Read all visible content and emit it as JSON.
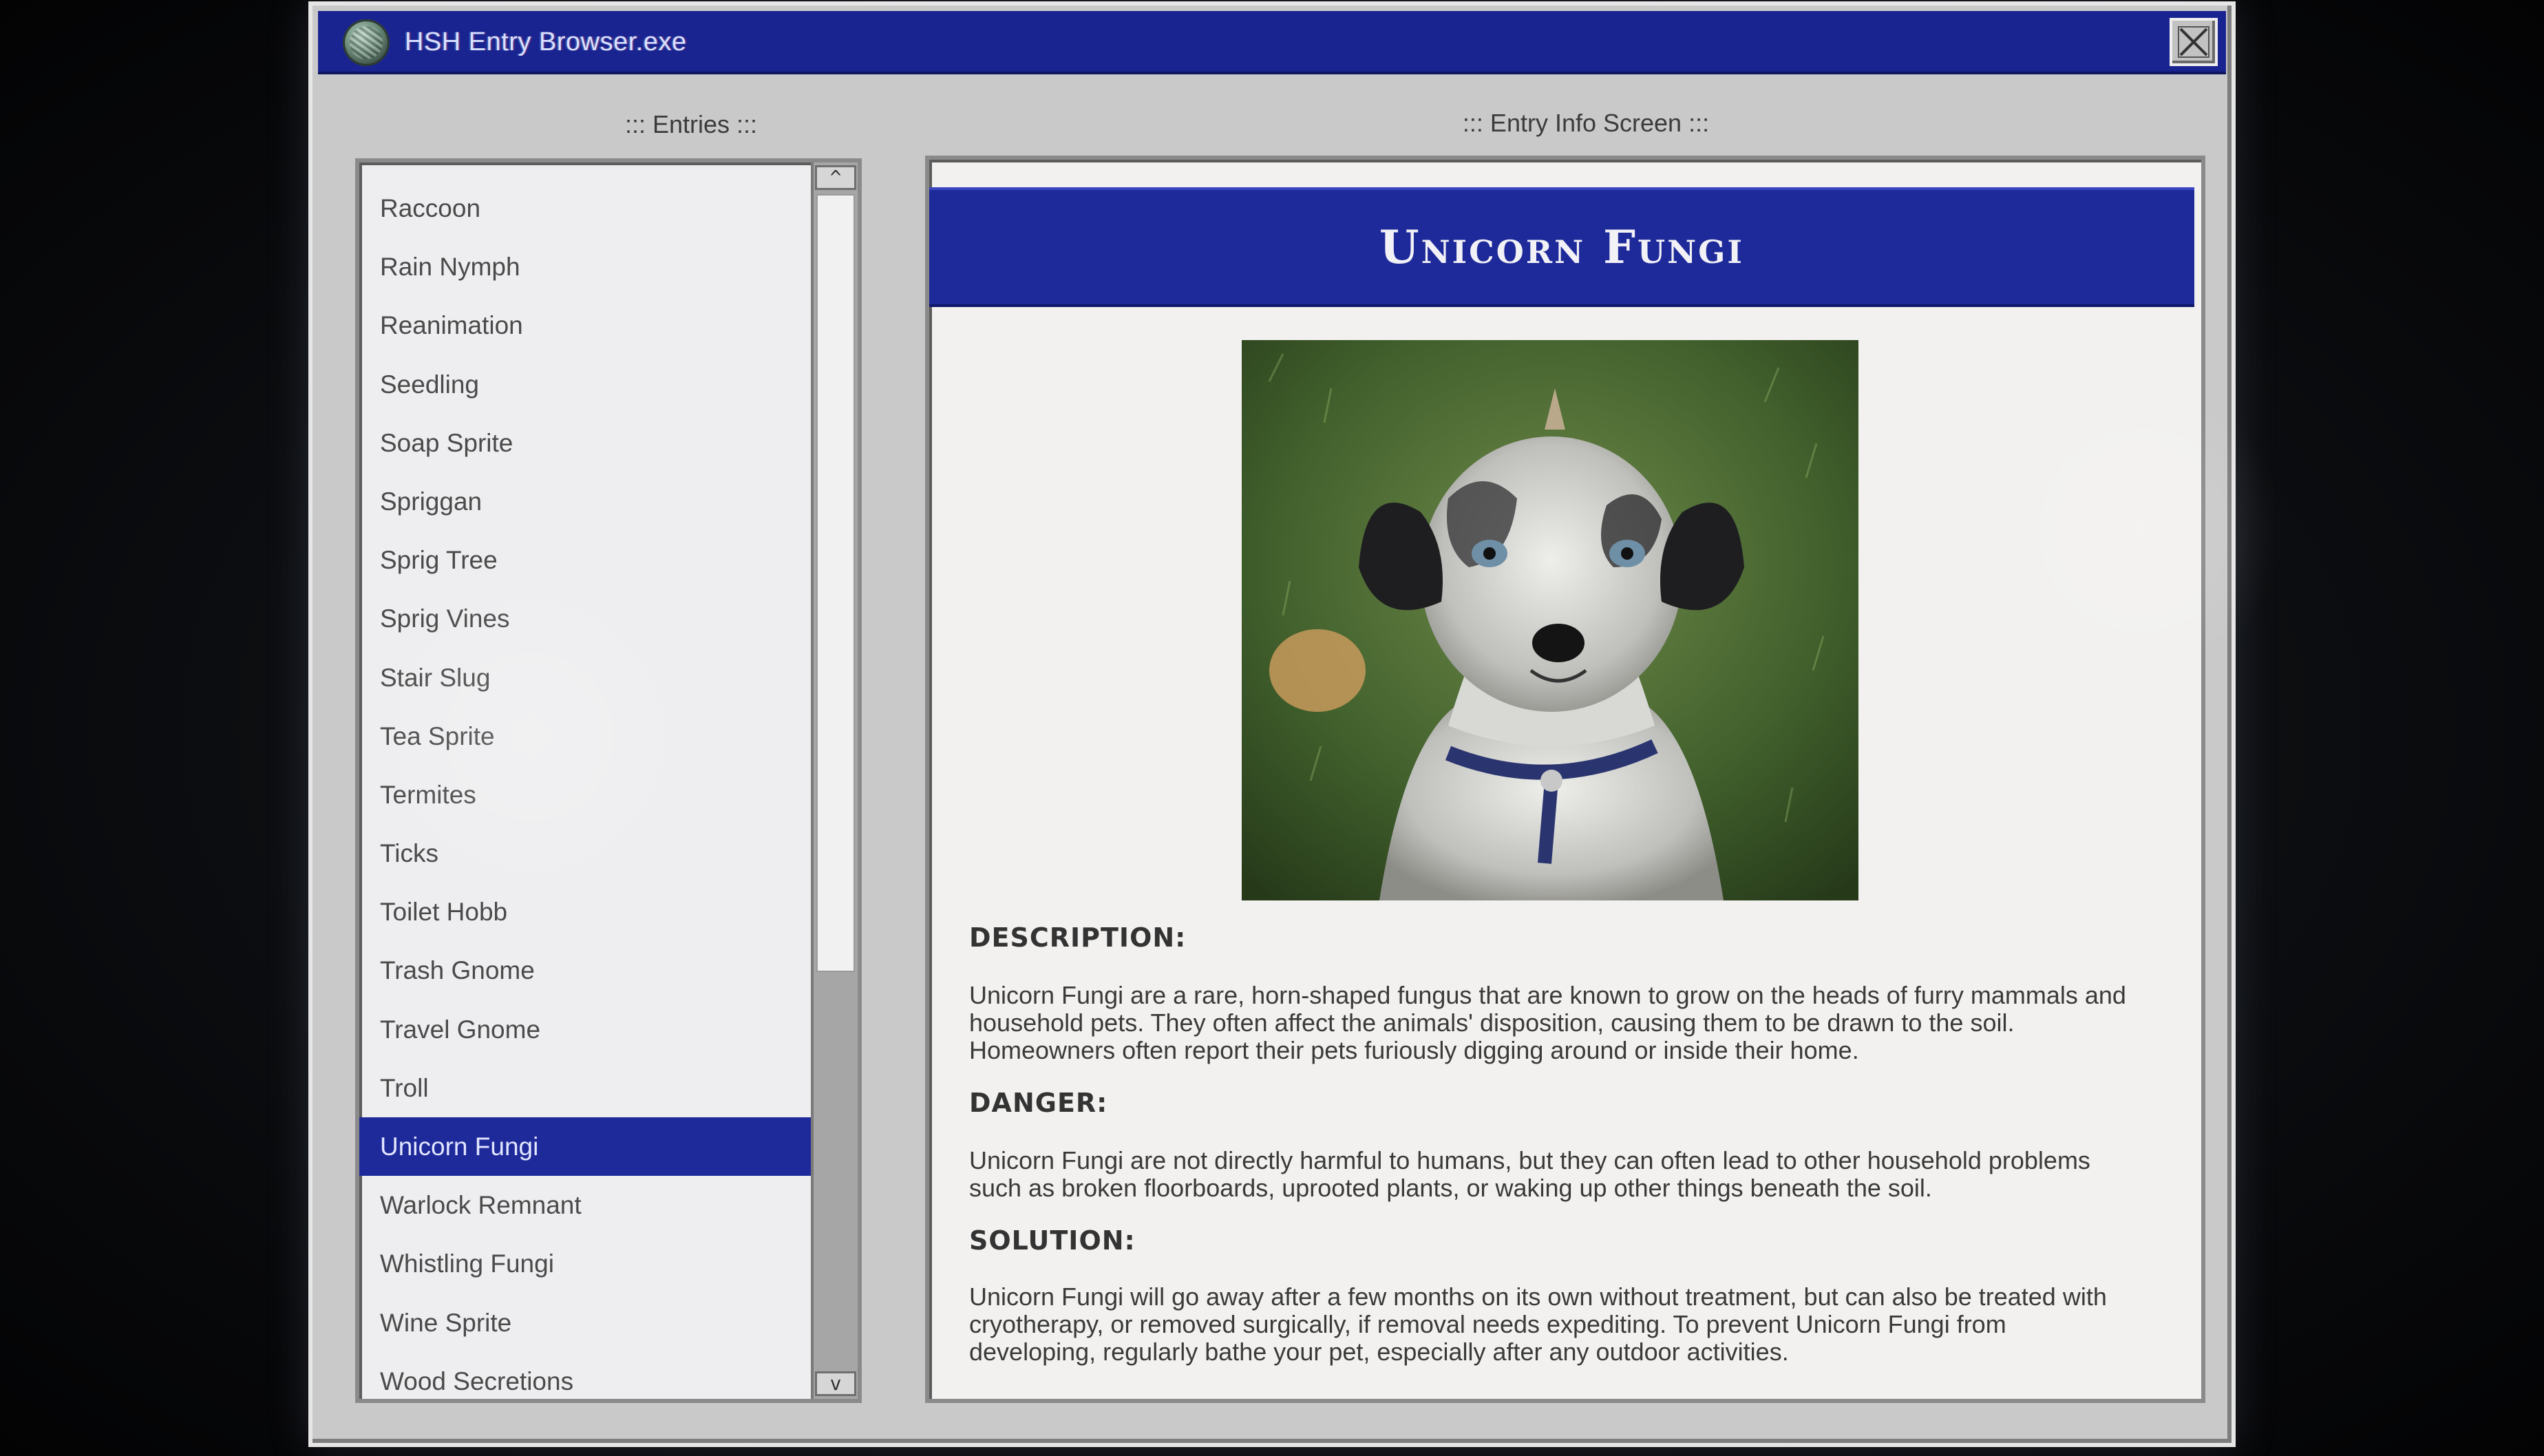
{
  "window": {
    "title": "HSH Entry Browser.exe",
    "icon": "globe-icon",
    "close_icon": "close-icon"
  },
  "entries_pane": {
    "label": "::: Entries :::",
    "scroll_up_glyph": "^",
    "scroll_down_glyph": "v",
    "items": [
      "Raccoon",
      "Rain Nymph",
      "Reanimation",
      "Seedling",
      "Soap Sprite",
      "Spriggan",
      "Sprig Tree",
      "Sprig Vines",
      "Stair Slug",
      "Tea Sprite",
      "Termites",
      "Ticks",
      "Toilet Hobb",
      "Trash Gnome",
      "Travel Gnome",
      "Troll",
      "Unicorn Fungi",
      "Warlock Remnant",
      "Whistling Fungi",
      "Wine Sprite",
      "Wood Secretions"
    ],
    "selected": "Unicorn Fungi"
  },
  "info_pane": {
    "label": "::: Entry Info Screen :::",
    "entry_title": "Unicorn Fungi",
    "sections": {
      "description_head": "DESCRIPTION:",
      "description_body": "Unicorn Fungi are a rare, horn-shaped fungus that are known to grow on the heads of furry mammals and household pets. They often affect the animals' disposition, causing them to be drawn to the soil. Homeowners often report their pets furiously digging around or inside their home.",
      "danger_head": "DANGER:",
      "danger_body": "Unicorn Fungi are not directly harmful to humans, but they can often lead to other household problems such as broken floorboards, uprooted plants, or waking up other things beneath the soil.",
      "solution_head": "SOLUTION:",
      "solution_body": "Unicorn Fungi will go away after a few months on its own without treatment, but can also be treated with cryotherapy, or removed surgically, if removal needs expediting. To prevent Unicorn Fungi from developing, regularly bathe your pet, especially after any outdoor activities."
    }
  },
  "colors": {
    "titlebar": "#1a2491",
    "selection": "#1f2a9a",
    "window_gray": "#c9c9c9"
  }
}
